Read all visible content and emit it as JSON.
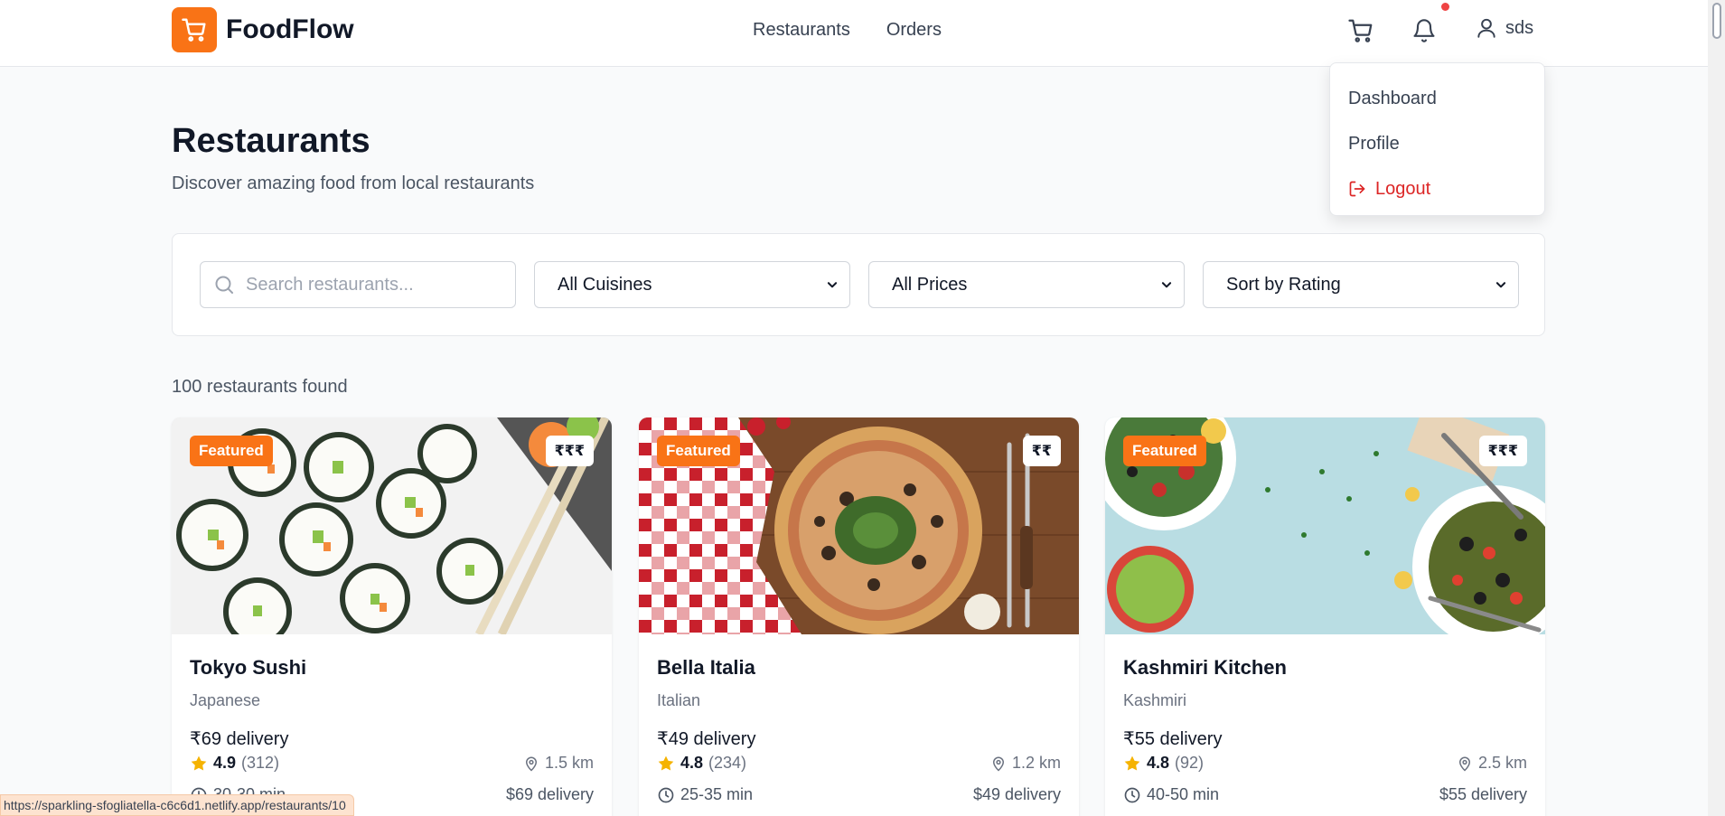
{
  "header": {
    "brand": "FoodFlow",
    "nav": [
      {
        "label": "Restaurants"
      },
      {
        "label": "Orders"
      }
    ],
    "user_name": "sds"
  },
  "user_menu": {
    "items": [
      {
        "label": "Dashboard"
      },
      {
        "label": "Profile"
      }
    ],
    "logout_label": "Logout"
  },
  "page": {
    "title": "Restaurants",
    "subtitle": "Discover amazing food from local restaurants"
  },
  "filters": {
    "search_placeholder": "Search restaurants...",
    "cuisine": "All Cuisines",
    "price": "All Prices",
    "sort": "Sort by Rating"
  },
  "results_count": "100 restaurants found",
  "restaurants": [
    {
      "badge": "Featured",
      "price_level": "₹₹₹",
      "name": "Tokyo Sushi",
      "cuisine": "Japanese",
      "delivery_fee": "₹69 delivery",
      "rating": "4.9",
      "reviews": "(312)",
      "distance": "1.5 km",
      "time": "30-30 min",
      "delivery_fee_right": "$69 delivery"
    },
    {
      "badge": "Featured",
      "price_level": "₹₹",
      "name": "Bella Italia",
      "cuisine": "Italian",
      "delivery_fee": "₹49 delivery",
      "rating": "4.8",
      "reviews": "(234)",
      "distance": "1.2 km",
      "time": "25-35 min",
      "delivery_fee_right": "$49 delivery"
    },
    {
      "badge": "Featured",
      "price_level": "₹₹₹",
      "name": "Kashmiri Kitchen",
      "cuisine": "Kashmiri",
      "delivery_fee": "₹55 delivery",
      "rating": "4.8",
      "reviews": "(92)",
      "distance": "2.5 km",
      "time": "40-50 min",
      "delivery_fee_right": "$55 delivery"
    }
  ],
  "status_bar_url": "https://sparkling-sfogliatella-c6c6d1.netlify.app/restaurants/10",
  "colors": {
    "accent": "#f97316",
    "danger": "#dc2626",
    "star": "#f5b301"
  }
}
